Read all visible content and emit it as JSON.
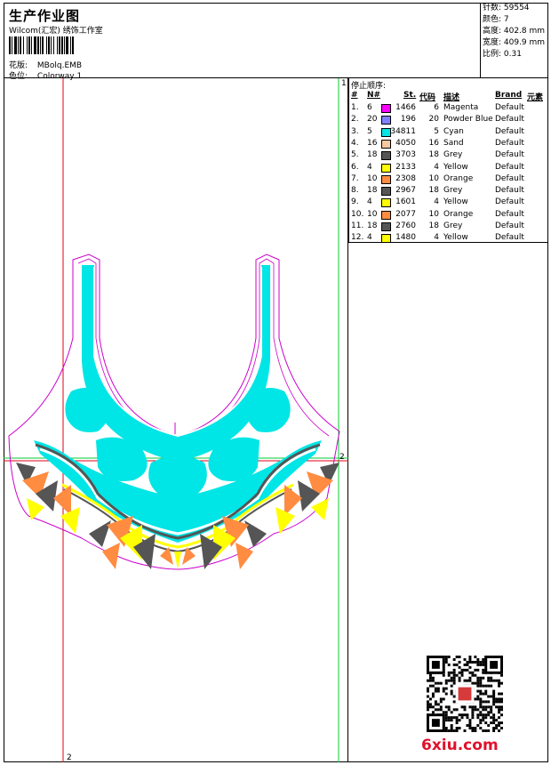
{
  "header": {
    "title": "生产作业图",
    "subtitle": "Wilcom(汇宏) 绣饰工作室",
    "design_label": "花版:",
    "design_value": "MBolq.EMB",
    "color_label": "色位:",
    "color_value": "Colorway 1"
  },
  "stats": {
    "stitches": "针数: 59554",
    "colors": "颜色: 7",
    "height": "高度: 402.8 mm",
    "width": "宽度: 409.9 mm",
    "scale": "比例: 0.31"
  },
  "sequence": {
    "title": "停止顺序:",
    "headers": [
      "#",
      "N#",
      "St.",
      "代码",
      "描述",
      "Brand",
      "元素"
    ],
    "rows": [
      {
        "idx": "1.",
        "n": "6",
        "color": "#ff00ff",
        "st": "1466",
        "code": "6",
        "desc": "Magenta",
        "brand": "Default"
      },
      {
        "idx": "2.",
        "n": "20",
        "color": "#8080ff",
        "st": "196",
        "code": "20",
        "desc": "Powder Blue",
        "brand": "Default"
      },
      {
        "idx": "3.",
        "n": "5",
        "color": "#00e5e5",
        "st": "34811",
        "code": "5",
        "desc": "Cyan",
        "brand": "Default"
      },
      {
        "idx": "4.",
        "n": "16",
        "color": "#f5c8a0",
        "st": "4050",
        "code": "16",
        "desc": "Sand",
        "brand": "Default"
      },
      {
        "idx": "5.",
        "n": "18",
        "color": "#555555",
        "st": "3703",
        "code": "18",
        "desc": "Grey",
        "brand": "Default"
      },
      {
        "idx": "6.",
        "n": "4",
        "color": "#ffff00",
        "st": "2133",
        "code": "4",
        "desc": "Yellow",
        "brand": "Default"
      },
      {
        "idx": "7.",
        "n": "10",
        "color": "#ff8c40",
        "st": "2308",
        "code": "10",
        "desc": "Orange",
        "brand": "Default"
      },
      {
        "idx": "8.",
        "n": "18",
        "color": "#555555",
        "st": "2967",
        "code": "18",
        "desc": "Grey",
        "brand": "Default"
      },
      {
        "idx": "9.",
        "n": "4",
        "color": "#ffff00",
        "st": "1601",
        "code": "4",
        "desc": "Yellow",
        "brand": "Default"
      },
      {
        "idx": "10.",
        "n": "10",
        "color": "#ff8c40",
        "st": "2077",
        "code": "10",
        "desc": "Orange",
        "brand": "Default"
      },
      {
        "idx": "11.",
        "n": "18",
        "color": "#555555",
        "st": "2760",
        "code": "18",
        "desc": "Grey",
        "brand": "Default"
      },
      {
        "idx": "12.",
        "n": "4",
        "color": "#ffff00",
        "st": "1480",
        "code": "4",
        "desc": "Yellow",
        "brand": "Default"
      }
    ]
  },
  "guides": {
    "label_1": "1",
    "label_2": "2"
  },
  "watermark": {
    "text": "6xiu.com"
  }
}
